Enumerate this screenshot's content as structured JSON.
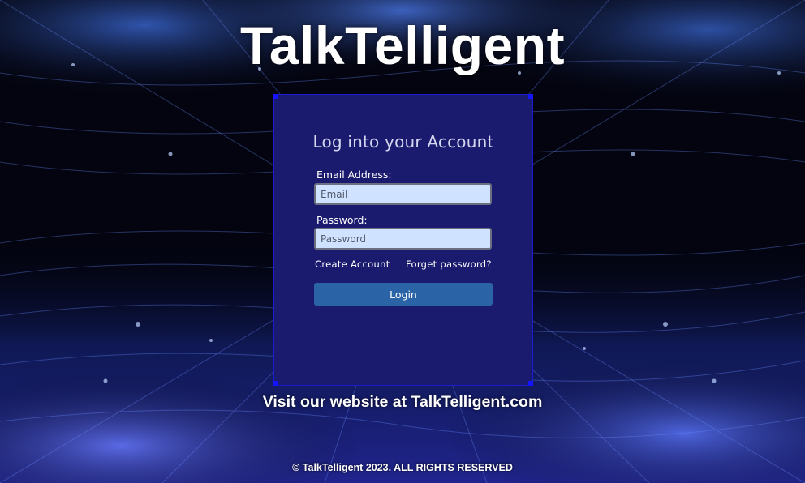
{
  "app": {
    "title": "TalkTelligent"
  },
  "login": {
    "heading": "Log into your Account",
    "email_label": "Email Address:",
    "email_placeholder": "Email",
    "email_value": "",
    "password_label": "Password:",
    "password_placeholder": "Password",
    "password_value": "",
    "create_account_label": "Create Account",
    "forgot_password_label": "Forget password?",
    "login_button_label": "Login"
  },
  "footer": {
    "visit_text": "Visit our website at TalkTelligent.com",
    "copyright": "© TalkTelligent 2023. ALL RIGHTS RESERVED"
  },
  "colors": {
    "panel": "#1a1a6e",
    "button": "#2a64a6",
    "input_bg": "#cfe2ff",
    "background": "#03040f",
    "glow": "#3a6cff"
  }
}
